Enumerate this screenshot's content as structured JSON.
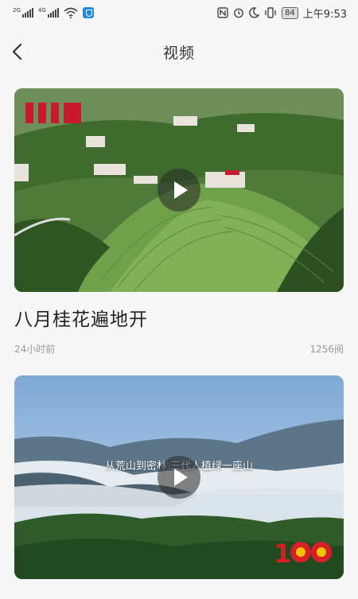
{
  "status_bar": {
    "network_1": "2G",
    "network_2": "4G",
    "battery": "84",
    "time": "上午9:53"
  },
  "nav": {
    "title": "视频"
  },
  "videos": [
    {
      "title": "八月桂花遍地开",
      "time": "24小时前",
      "views": "1256阅"
    },
    {
      "overlay_caption": "从荒山到密林 三代人植绿一座山"
    }
  ]
}
